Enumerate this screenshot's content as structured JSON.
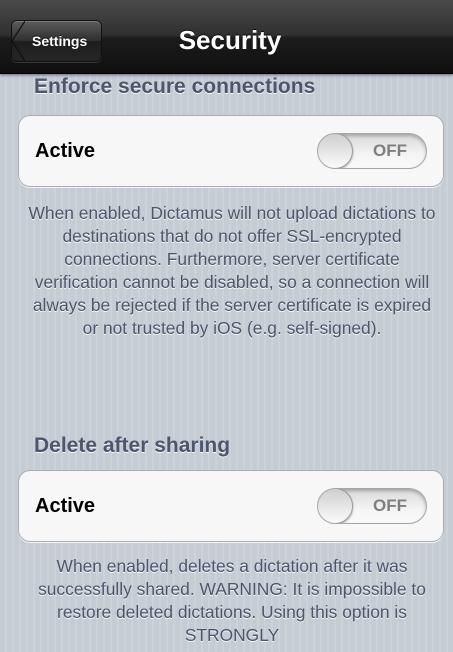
{
  "navbar": {
    "back_label": "Settings",
    "title": "Security"
  },
  "sections": [
    {
      "header": "Enforce secure connections",
      "cell_label": "Active",
      "toggle_text": "OFF",
      "toggle_on": false,
      "footer": "When enabled, Dictamus will not upload dictations to destinations that do not offer SSL-encrypted connections. Furthermore, server certificate verification cannot be disabled, so a connection will always be rejected if the server certificate is expired or not trusted by iOS (e.g. self-signed)."
    },
    {
      "header": "Delete after sharing",
      "cell_label": "Active",
      "toggle_text": "OFF",
      "toggle_on": false,
      "footer": "When enabled, deletes a dictation after it was successfully shared. WARNING: It is impossible to restore deleted dictations. Using this option is STRONGLY"
    }
  ],
  "colors": {
    "background": "#c5ccd4",
    "section_text": "#4c566c",
    "navbar": "#1c1c1c"
  }
}
